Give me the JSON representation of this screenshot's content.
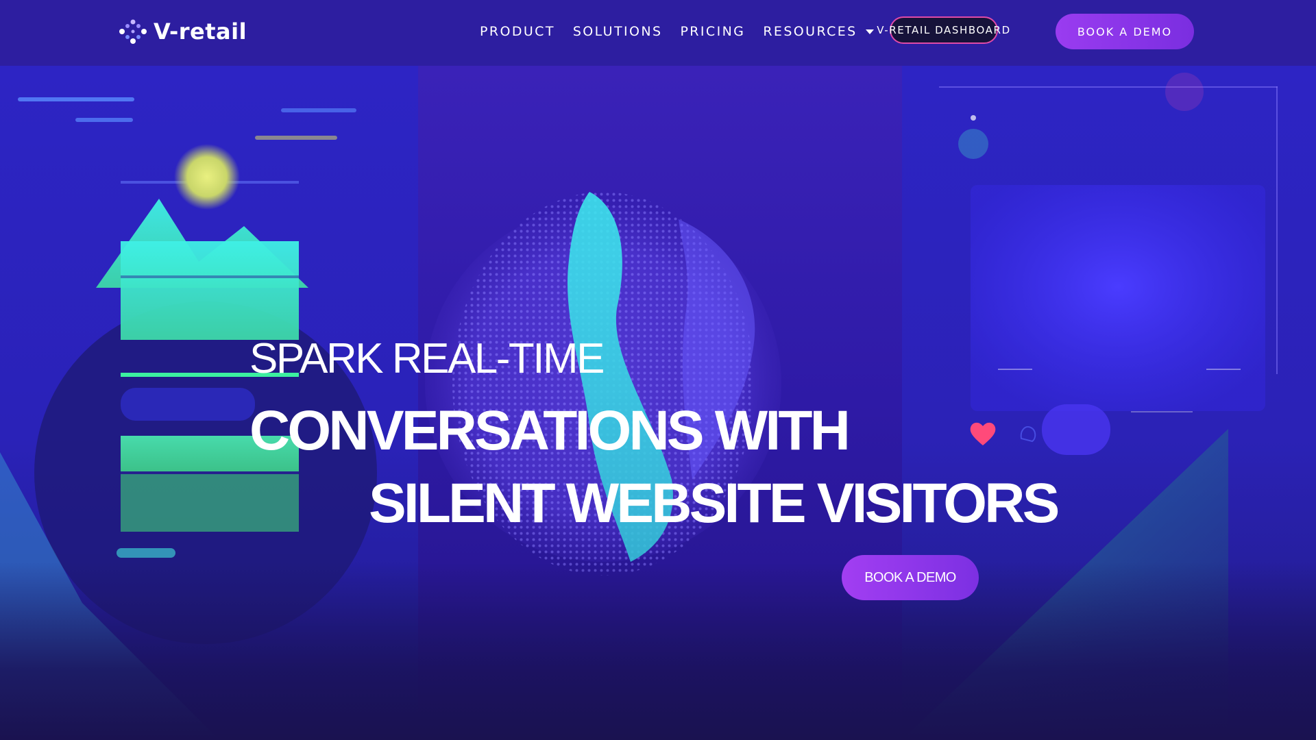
{
  "brand": {
    "name": "V-retail",
    "accent": "#8a36ec",
    "dashboard_border": "#e04aa8"
  },
  "nav": {
    "items": [
      {
        "label": "PRODUCT",
        "has_dropdown": false
      },
      {
        "label": "SOLUTIONS",
        "has_dropdown": false
      },
      {
        "label": "PRICING",
        "has_dropdown": false
      },
      {
        "label": "RESOURCES",
        "has_dropdown": true
      }
    ],
    "dashboard_label": "V-RETAIL DASHBOARD",
    "demo_label": "BOOK A DEMO"
  },
  "hero": {
    "line1": "SPARK REAL-TIME",
    "line2": "CONVERSATIONS WITH",
    "line3": "SILENT WEBSITE VISITORS",
    "cta_label": "BOOK A DEMO"
  },
  "icons": [
    "logo-dots-icon",
    "chevron-down-icon",
    "heart-icon",
    "globe-illustration",
    "mountain-illustration"
  ]
}
